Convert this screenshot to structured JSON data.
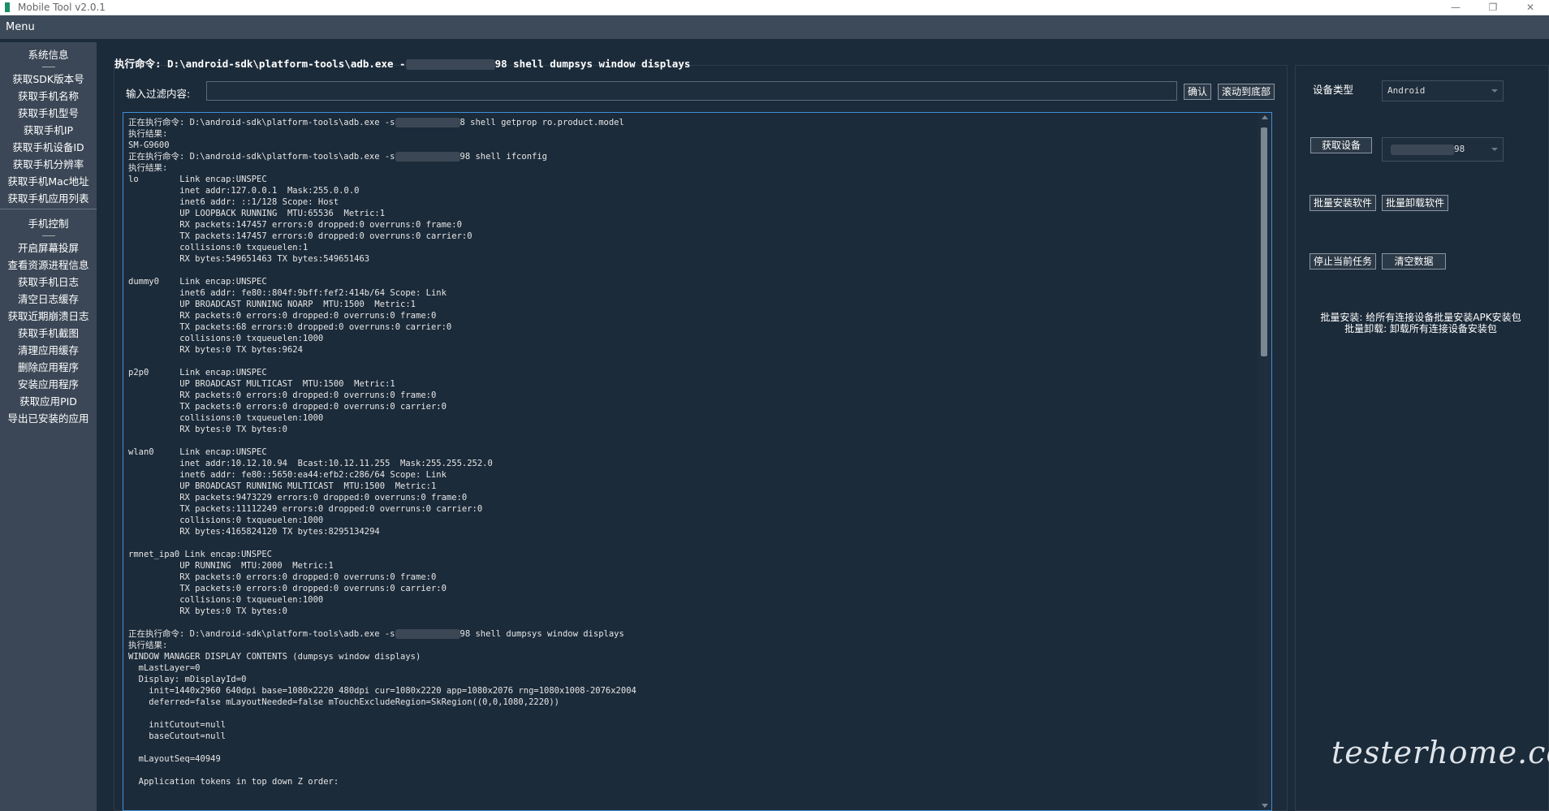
{
  "window": {
    "title": "Mobile Tool v2.0.1",
    "minimize": "—",
    "restore": "❐",
    "close": "✕"
  },
  "menubar": {
    "menu": "Menu"
  },
  "sidebar": {
    "section1": "系统信息",
    "items1": [
      "获取SDK版本号",
      "获取手机名称",
      "获取手机型号",
      "获取手机IP",
      "获取手机设备ID",
      "获取手机分辨率",
      "获取手机Mac地址",
      "获取手机应用列表"
    ],
    "section2": "手机控制",
    "items2": [
      "开启屏幕投屏",
      "查看资源进程信息",
      "获取手机日志",
      "清空日志缓存",
      "获取近期崩溃日志",
      "获取手机截图",
      "清理应用缓存",
      "删除应用程序",
      "安装应用程序",
      "获取应用PID",
      "导出已安装的应用"
    ]
  },
  "command": {
    "prefix": "执行命令: D:\\android-sdk\\platform-tools\\adb.exe -",
    "suffix": "98 shell dumpsys window displays"
  },
  "filter": {
    "label": "输入过滤内容:",
    "value": "",
    "confirm": "确认",
    "scroll_bottom": "滚动到底部"
  },
  "log": {
    "blocks": [
      {
        "cmd_prefix": "正在执行命令: D:\\android-sdk\\platform-tools\\adb.exe -s",
        "cmd_suffix": "8 shell getprop ro.product.model",
        "body": "执行结果:\nSM-G9600\n"
      },
      {
        "cmd_prefix": "正在执行命令: D:\\android-sdk\\platform-tools\\adb.exe -s",
        "cmd_suffix": "98 shell ifconfig",
        "body": "执行结果:\nlo        Link encap:UNSPEC\n          inet addr:127.0.0.1  Mask:255.0.0.0\n          inet6 addr: ::1/128 Scope: Host\n          UP LOOPBACK RUNNING  MTU:65536  Metric:1\n          RX packets:147457 errors:0 dropped:0 overruns:0 frame:0\n          TX packets:147457 errors:0 dropped:0 overruns:0 carrier:0\n          collisions:0 txqueuelen:1\n          RX bytes:549651463 TX bytes:549651463\n\ndummy0    Link encap:UNSPEC\n          inet6 addr: fe80::804f:9bff:fef2:414b/64 Scope: Link\n          UP BROADCAST RUNNING NOARP  MTU:1500  Metric:1\n          RX packets:0 errors:0 dropped:0 overruns:0 frame:0\n          TX packets:68 errors:0 dropped:0 overruns:0 carrier:0\n          collisions:0 txqueuelen:1000\n          RX bytes:0 TX bytes:9624\n\np2p0      Link encap:UNSPEC\n          UP BROADCAST MULTICAST  MTU:1500  Metric:1\n          RX packets:0 errors:0 dropped:0 overruns:0 frame:0\n          TX packets:0 errors:0 dropped:0 overruns:0 carrier:0\n          collisions:0 txqueuelen:1000\n          RX bytes:0 TX bytes:0\n\nwlan0     Link encap:UNSPEC\n          inet addr:10.12.10.94  Bcast:10.12.11.255  Mask:255.255.252.0\n          inet6 addr: fe80::5650:ea44:efb2:c286/64 Scope: Link\n          UP BROADCAST RUNNING MULTICAST  MTU:1500  Metric:1\n          RX packets:9473229 errors:0 dropped:0 overruns:0 frame:0\n          TX packets:11112249 errors:0 dropped:0 overruns:0 carrier:0\n          collisions:0 txqueuelen:1000\n          RX bytes:4165824120 TX bytes:8295134294\n\nrmnet_ipa0 Link encap:UNSPEC\n          UP RUNNING  MTU:2000  Metric:1\n          RX packets:0 errors:0 dropped:0 overruns:0 frame:0\n          TX packets:0 errors:0 dropped:0 overruns:0 carrier:0\n          collisions:0 txqueuelen:1000\n          RX bytes:0 TX bytes:0\n\n"
      },
      {
        "cmd_prefix": "正在执行命令: D:\\android-sdk\\platform-tools\\adb.exe -s",
        "cmd_suffix": "98 shell dumpsys window displays",
        "body": "执行结果:\nWINDOW MANAGER DISPLAY CONTENTS (dumpsys window displays)\n  mLastLayer=0\n  Display: mDisplayId=0\n    init=1440x2960 640dpi base=1080x2220 480dpi cur=1080x2220 app=1080x2076 rng=1080x1008-2076x2004\n    deferred=false mLayoutNeeded=false mTouchExcludeRegion=SkRegion((0,0,1080,2220))\n\n    initCutout=null\n    baseCutout=null\n\n  mLayoutSeq=40949\n\n  Application tokens in top down Z order:"
      }
    ]
  },
  "right": {
    "device_type_label": "设备类型",
    "device_type_value": "Android",
    "get_device": "获取设备",
    "device_value_suffix": "98",
    "batch_install": "批量安装软件",
    "batch_uninstall": "批量卸载软件",
    "stop_task": "停止当前任务",
    "clear_data": "清空数据",
    "help_line1": "批量安装: 给所有连接设备批量安装APK安装包",
    "help_line2": "批量卸载: 卸载所有连接设备安装包"
  },
  "watermark": "testerhome.com",
  "colors": {
    "background": "#1c2b3a",
    "sidebar": "#3b4756",
    "log_border": "#3f8fd8"
  }
}
